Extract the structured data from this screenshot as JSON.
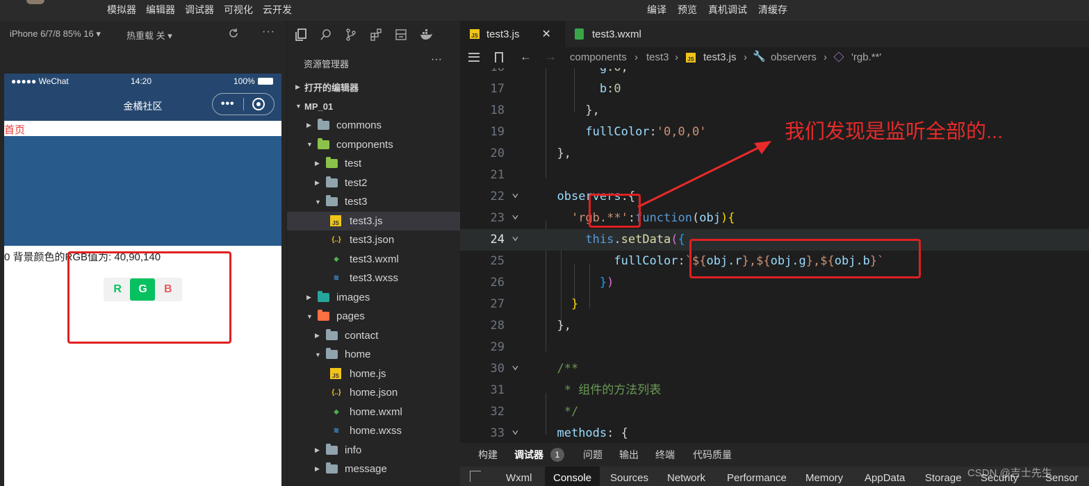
{
  "menubar": {
    "left_items": [
      "模拟器",
      "编辑器",
      "调试器",
      "可视化",
      "云开发"
    ],
    "right_items": [
      "编译",
      "预览",
      "真机调试",
      "清缓存"
    ]
  },
  "simulator": {
    "device": "iPhone 6/7/8 85% 16 ▾",
    "hot_reload": "热重载 关 ▾",
    "more": "···",
    "status_signal": "●●●●● WeChat",
    "status_time": "14:20",
    "status_battery": "100%",
    "nav_title": "金橘社区",
    "capsule_dots": "•••",
    "home_link": "首页",
    "block_color": "#285a8c",
    "rgb_text": "0 背景颜色的RGB值为: 40,90,140",
    "buttons": {
      "r": "R",
      "g": "G",
      "b": "B"
    }
  },
  "explorer": {
    "title": "资源管理器",
    "more": "···",
    "tree": [
      {
        "label": "打开的编辑器",
        "depth": 0,
        "kind": "section",
        "open": false,
        "name": "tree-open-editors"
      },
      {
        "label": "MP_01",
        "depth": 0,
        "kind": "section",
        "open": true,
        "name": "tree-project-root"
      },
      {
        "label": "commons",
        "depth": 1,
        "kind": "folder",
        "open": false,
        "name": "tree-folder-commons"
      },
      {
        "label": "components",
        "depth": 1,
        "kind": "folder-special",
        "open": true,
        "name": "tree-folder-components"
      },
      {
        "label": "test",
        "depth": 2,
        "kind": "folder-special",
        "open": false,
        "name": "tree-folder-test"
      },
      {
        "label": "test2",
        "depth": 2,
        "kind": "folder",
        "open": false,
        "name": "tree-folder-test2"
      },
      {
        "label": "test3",
        "depth": 2,
        "kind": "folder",
        "open": true,
        "name": "tree-folder-test3"
      },
      {
        "label": "test3.js",
        "depth": 3,
        "kind": "js",
        "selected": true,
        "name": "tree-file-test3-js"
      },
      {
        "label": "test3.json",
        "depth": 3,
        "kind": "json",
        "name": "tree-file-test3-json"
      },
      {
        "label": "test3.wxml",
        "depth": 3,
        "kind": "wxml",
        "name": "tree-file-test3-wxml"
      },
      {
        "label": "test3.wxss",
        "depth": 3,
        "kind": "wxss",
        "name": "tree-file-test3-wxss"
      },
      {
        "label": "images",
        "depth": 1,
        "kind": "folder-images",
        "open": false,
        "name": "tree-folder-images"
      },
      {
        "label": "pages",
        "depth": 1,
        "kind": "folder-pages",
        "open": true,
        "name": "tree-folder-pages"
      },
      {
        "label": "contact",
        "depth": 2,
        "kind": "folder",
        "open": false,
        "name": "tree-folder-contact"
      },
      {
        "label": "home",
        "depth": 2,
        "kind": "folder",
        "open": true,
        "name": "tree-folder-home"
      },
      {
        "label": "home.js",
        "depth": 3,
        "kind": "js",
        "name": "tree-file-home-js"
      },
      {
        "label": "home.json",
        "depth": 3,
        "kind": "json",
        "name": "tree-file-home-json"
      },
      {
        "label": "home.wxml",
        "depth": 3,
        "kind": "wxml",
        "name": "tree-file-home-wxml"
      },
      {
        "label": "home.wxss",
        "depth": 3,
        "kind": "wxss",
        "name": "tree-file-home-wxss"
      },
      {
        "label": "info",
        "depth": 2,
        "kind": "folder",
        "open": false,
        "name": "tree-folder-info"
      },
      {
        "label": "message",
        "depth": 2,
        "kind": "folder",
        "open": false,
        "name": "tree-folder-message"
      }
    ]
  },
  "editor": {
    "tabs": [
      {
        "label": "test3.js",
        "icon": "JS",
        "active": true,
        "close": "✕"
      },
      {
        "label": "test3.wxml",
        "icon": "wxml",
        "active": false
      }
    ],
    "breadcrumb": {
      "p1": "components",
      "p2": "test3",
      "p3": "test3.js",
      "p4": "observers",
      "p5": "'rgb.**'"
    },
    "lines": [
      {
        "n": "17",
        "fold": false,
        "segs": [
          [
            "        ",
            "#d4d4d4"
          ],
          [
            "b",
            "#9cdcfe"
          ],
          [
            ":",
            "#d4d4d4"
          ],
          [
            "0",
            "#b5cea8"
          ]
        ]
      },
      {
        "n": "18",
        "fold": false,
        "segs": [
          [
            "      },",
            "#d4d4d4"
          ]
        ]
      },
      {
        "n": "19",
        "fold": false,
        "segs": [
          [
            "      ",
            "#d4d4d4"
          ],
          [
            "fullColor",
            "#9cdcfe"
          ],
          [
            ":",
            "#d4d4d4"
          ],
          [
            "'0,0,0'",
            "#ce9178"
          ]
        ]
      },
      {
        "n": "20",
        "fold": false,
        "segs": [
          [
            "  },",
            "#d4d4d4"
          ]
        ]
      },
      {
        "n": "21",
        "fold": false,
        "segs": []
      },
      {
        "n": "22",
        "fold": true,
        "segs": [
          [
            "  ",
            "#d4d4d4"
          ],
          [
            "observers",
            "#9cdcfe"
          ],
          [
            ":{",
            "#d4d4d4"
          ]
        ]
      },
      {
        "n": "23",
        "fold": true,
        "segs": [
          [
            "    ",
            "#d4d4d4"
          ],
          [
            "'rgb.**'",
            "#ce9178"
          ],
          [
            ":",
            "#d4d4d4"
          ],
          [
            "function",
            "#569cd6"
          ],
          [
            "(",
            "#d4d4d4"
          ],
          [
            "obj",
            "#9cdcfe"
          ],
          [
            "){",
            "#ffd700"
          ]
        ]
      },
      {
        "n": "24",
        "fold": true,
        "cur": true,
        "segs": [
          [
            "      ",
            "#d4d4d4"
          ],
          [
            "this",
            "#569cd6"
          ],
          [
            ".",
            "#d4d4d4"
          ],
          [
            "setData",
            "#dcdcaa"
          ],
          [
            "(",
            "#da70d6"
          ],
          [
            "{",
            "#179fff"
          ]
        ]
      },
      {
        "n": "25",
        "fold": false,
        "segs": [
          [
            "          ",
            "#d4d4d4"
          ],
          [
            "fullColor",
            "#9cdcfe"
          ],
          [
            ":",
            "#d4d4d4"
          ],
          [
            "`${",
            "#ce9178"
          ],
          [
            "obj.r",
            "#9cdcfe"
          ],
          [
            "},${",
            "#ce9178"
          ],
          [
            "obj.g",
            "#9cdcfe"
          ],
          [
            "},${",
            "#ce9178"
          ],
          [
            "obj.b",
            "#9cdcfe"
          ],
          [
            "}`",
            "#ce9178"
          ]
        ]
      },
      {
        "n": "26",
        "fold": false,
        "segs": [
          [
            "        ",
            "#d4d4d4"
          ],
          [
            "}",
            "#179fff"
          ],
          [
            ")",
            "#da70d6"
          ]
        ]
      },
      {
        "n": "27",
        "fold": false,
        "segs": [
          [
            "    ",
            "#d4d4d4"
          ],
          [
            "}",
            "#ffd700"
          ]
        ]
      },
      {
        "n": "28",
        "fold": false,
        "segs": [
          [
            "  },",
            "#d4d4d4"
          ]
        ]
      },
      {
        "n": "29",
        "fold": false,
        "segs": []
      },
      {
        "n": "30",
        "fold": true,
        "segs": [
          [
            "  ",
            "#d4d4d4"
          ],
          [
            "/**",
            "#6a9955"
          ]
        ]
      },
      {
        "n": "31",
        "fold": false,
        "segs": [
          [
            "   ",
            "#d4d4d4"
          ],
          [
            "* 组件的方法列表",
            "#6a9955"
          ]
        ]
      },
      {
        "n": "32",
        "fold": false,
        "segs": [
          [
            "   ",
            "#d4d4d4"
          ],
          [
            "*/",
            "#6a9955"
          ]
        ]
      },
      {
        "n": "33",
        "fold": true,
        "segs": [
          [
            "  ",
            "#d4d4d4"
          ],
          [
            "methods",
            "#9cdcfe"
          ],
          [
            ": {",
            "#d4d4d4"
          ]
        ]
      }
    ]
  },
  "panel": {
    "tabs": [
      "构建",
      "调试器",
      "问题",
      "输出",
      "终端",
      "代码质量"
    ],
    "badge": "1",
    "devtools": [
      "Wxml",
      "Console",
      "Sources",
      "Network",
      "Performance",
      "Memory",
      "AppData",
      "Storage",
      "Security",
      "Sensor"
    ]
  },
  "annotation": "我们发现是监听全部的...",
  "watermark": "CSDN @吉士先生",
  "colors": {
    "accent_red": "#e02020",
    "nav_blue": "#25476f",
    "wechat_green": "#07c160"
  }
}
